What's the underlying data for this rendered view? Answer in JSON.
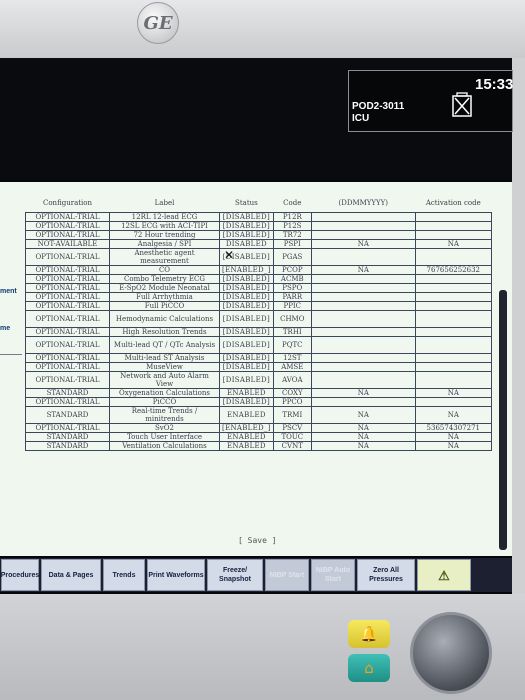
{
  "header": {
    "logo_text": "GE"
  },
  "status_bar": {
    "bed_id": "POD2-3011",
    "unit": "ICU",
    "time": "15:33",
    "battery_icon": "battery-empty-icon"
  },
  "side_menu": {
    "items": [
      "ment",
      "me"
    ]
  },
  "table": {
    "columns": [
      "Configuration",
      "Label",
      "Status",
      "Code",
      "(DDMMYYYY)",
      "Activation code"
    ],
    "rows": [
      {
        "config": "OPTIONAL-TRIAL",
        "label": "12RL 12-lead ECG",
        "status": "[DISABLED]",
        "code": "P12R",
        "expiry": "",
        "activation": ""
      },
      {
        "config": "OPTIONAL-TRIAL",
        "label": "12SL ECG with ACI-TIPI",
        "status": "[DISABLED]",
        "code": "P12S",
        "expiry": "",
        "activation": ""
      },
      {
        "config": "OPTIONAL-TRIAL",
        "label": "72 Hour trending",
        "status": "[DISABLED]",
        "code": "TR72",
        "expiry": "",
        "activation": ""
      },
      {
        "config": "NOT-AVAILABLE",
        "label": "Analgesia / SPI",
        "status": "DISABLED",
        "code": "PSPI",
        "expiry": "NA",
        "activation": "NA"
      },
      {
        "config": "OPTIONAL-TRIAL",
        "label": "Anesthetic agent measurement",
        "status": "[DISABLED]",
        "code": "PGAS",
        "expiry": "",
        "activation": ""
      },
      {
        "config": "OPTIONAL-TRIAL",
        "label": "CO",
        "status": "[ENABLED_]",
        "code": "PCOP",
        "expiry": "NA",
        "activation": "767656252632"
      },
      {
        "config": "OPTIONAL-TRIAL",
        "label": "Combo Telemetry ECG",
        "status": "[DISABLED]",
        "code": "ACMB",
        "expiry": "",
        "activation": ""
      },
      {
        "config": "OPTIONAL-TRIAL",
        "label": "E-SpO2 Module Neonatal",
        "status": "[DISABLED]",
        "code": "PSPO",
        "expiry": "",
        "activation": ""
      },
      {
        "config": "OPTIONAL-TRIAL",
        "label": "Full Arrhythmia",
        "status": "[DISABLED]",
        "code": "PARR",
        "expiry": "",
        "activation": ""
      },
      {
        "config": "OPTIONAL-TRIAL",
        "label": "Full PiCCO",
        "status": "[DISABLED]",
        "code": "PPIC",
        "expiry": "",
        "activation": ""
      },
      {
        "config": "OPTIONAL-TRIAL",
        "label": "Hemodynamic Calculations",
        "status": "[DISABLED]",
        "code": "CHMO",
        "expiry": "",
        "activation": ""
      },
      {
        "config": "OPTIONAL-TRIAL",
        "label": "High Resolution Trends",
        "status": "[DISABLED]",
        "code": "TRHI",
        "expiry": "",
        "activation": ""
      },
      {
        "config": "OPTIONAL-TRIAL",
        "label": "Multi-lead QT / QTc Analysis",
        "status": "[DISABLED]",
        "code": "PQTC",
        "expiry": "",
        "activation": ""
      },
      {
        "config": "OPTIONAL-TRIAL",
        "label": "Multi-lead ST Analysis",
        "status": "[DISABLED]",
        "code": "12ST",
        "expiry": "",
        "activation": ""
      },
      {
        "config": "OPTIONAL-TRIAL",
        "label": "MuseView",
        "status": "[DISABLED]",
        "code": "AMSE",
        "expiry": "",
        "activation": ""
      },
      {
        "config": "OPTIONAL-TRIAL",
        "label": "Network and Auto Alarm View",
        "status": "[DISABLED]",
        "code": "AVOA",
        "expiry": "",
        "activation": ""
      },
      {
        "config": "STANDARD",
        "label": "Oxygenation Calculations",
        "status": "ENABLED",
        "code": "COXY",
        "expiry": "NA",
        "activation": "NA"
      },
      {
        "config": "OPTIONAL-TRIAL",
        "label": "PiCCO",
        "status": "[DISABLED]",
        "code": "PPCO",
        "expiry": "",
        "activation": ""
      },
      {
        "config": "STANDARD",
        "label": "Real-time Trends / minitrends",
        "status": "ENABLED",
        "code": "TRMI",
        "expiry": "NA",
        "activation": "NA"
      },
      {
        "config": "OPTIONAL-TRIAL",
        "label": "SvO2",
        "status": "[ENABLED_]",
        "code": "PSCV",
        "expiry": "NA",
        "activation": "536574307271"
      },
      {
        "config": "STANDARD",
        "label": "Touch User Interface",
        "status": "ENABLED",
        "code": "TOUC",
        "expiry": "NA",
        "activation": "NA"
      },
      {
        "config": "STANDARD",
        "label": "Ventilation Calculations",
        "status": "ENABLED",
        "code": "CVNT",
        "expiry": "NA",
        "activation": "NA"
      }
    ]
  },
  "save_label": "[ Save ]",
  "softkeys": [
    {
      "label": "Procedures",
      "state": "active"
    },
    {
      "label": "Data & Pages",
      "state": "active"
    },
    {
      "label": "Trends",
      "state": "active"
    },
    {
      "label": "Print Waveforms",
      "state": "active"
    },
    {
      "label": "Freeze/ Snapshot",
      "state": "active"
    },
    {
      "label": "NIBP Start",
      "state": "disabled"
    },
    {
      "label": "NIBP Auto Start",
      "state": "disabled"
    },
    {
      "label": "Zero All Pressures",
      "state": "active"
    },
    {
      "label": "⚠",
      "state": "alarm"
    }
  ],
  "hardware": {
    "silence_icon": "alarm-silence-icon",
    "home_icon": "home-icon"
  },
  "colors": {
    "panel_bg": "#f0f7ef",
    "screen_bg": "#060709",
    "softkey_bg": "#d3dbe9",
    "silence_btn": "#f6e95f",
    "home_btn": "#3fc0b6"
  }
}
